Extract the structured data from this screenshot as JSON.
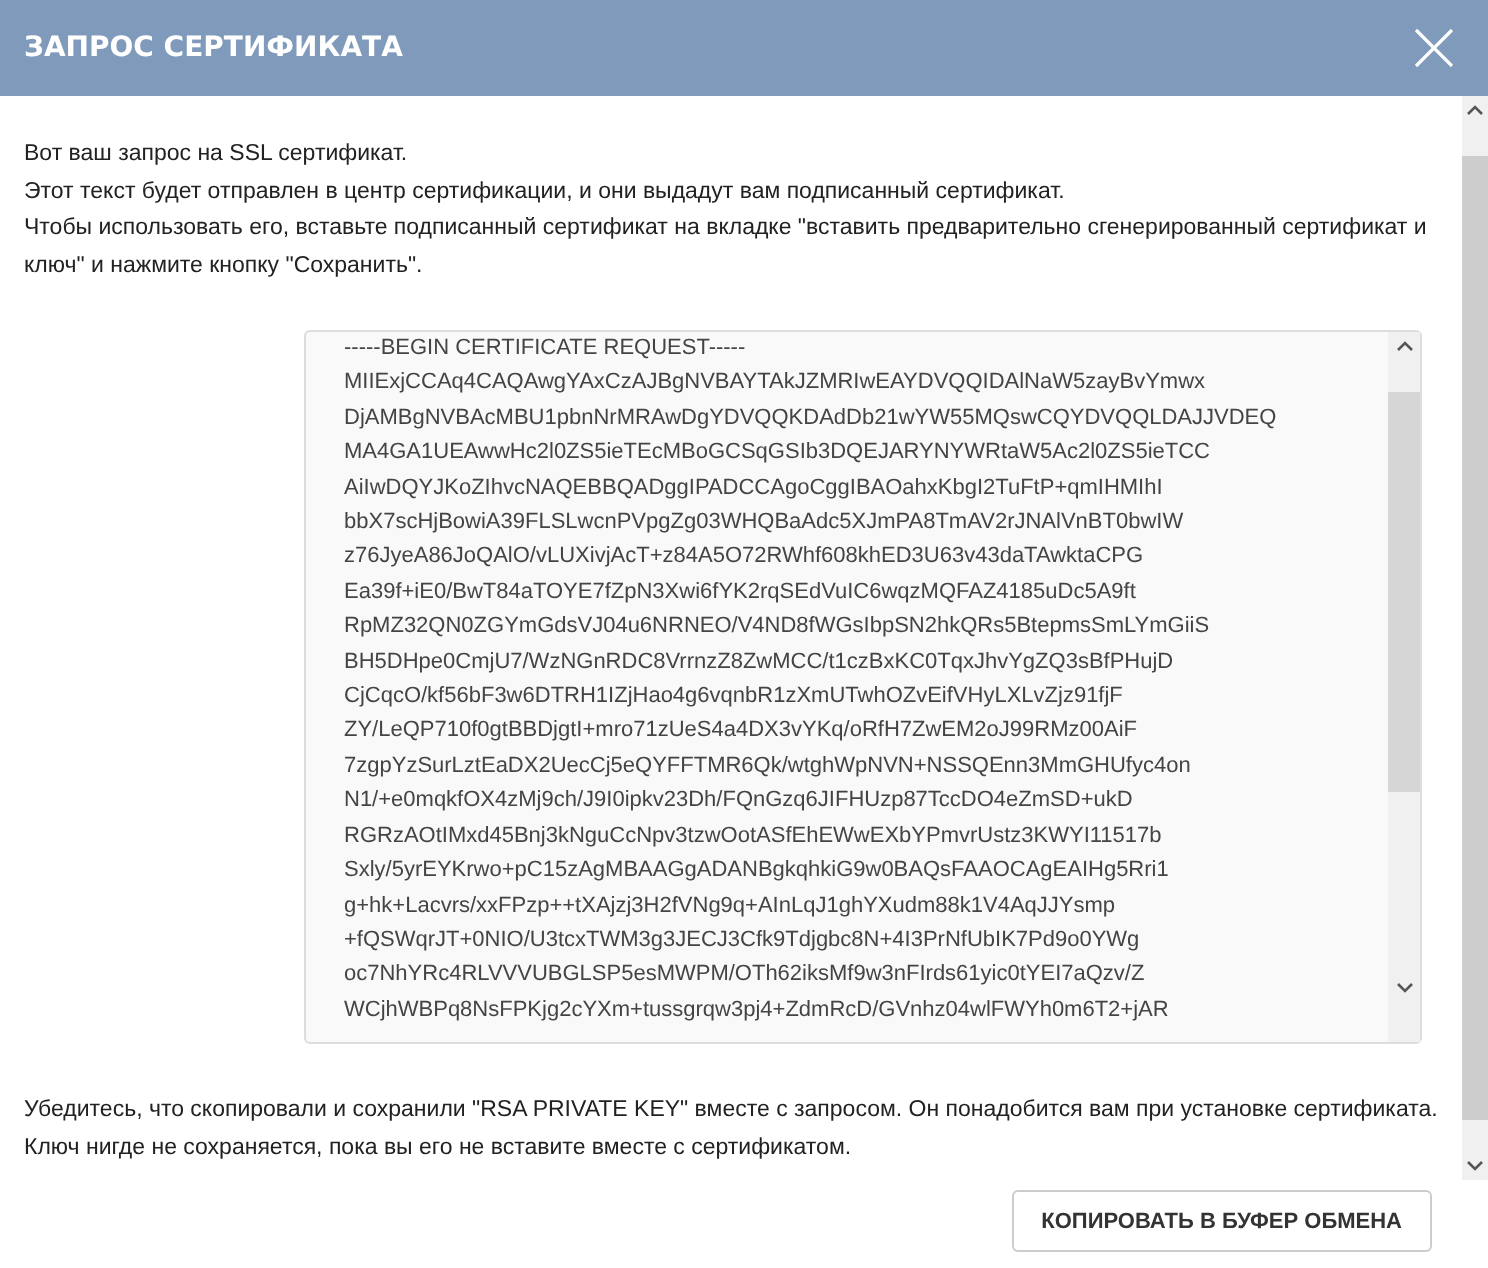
{
  "dialog": {
    "title": "ЗАПРОС СЕРТИФИКАТА"
  },
  "intro": [
    "Вот ваш запрос на SSL сертификат.",
    "Этот текст будет отправлен в центр сертификации, и они выдадут вам подписанный сертификат.",
    "Чтобы использовать его, вставьте подписанный сертификат на вкладке \"вставить предварительно сгенерированный сертификат и ключ\" и нажмите кнопку \"Сохранить\"."
  ],
  "certificate_request": {
    "lines": [
      "-----BEGIN CERTIFICATE REQUEST-----",
      "MIIExjCCAq4CAQAwgYAxCzAJBgNVBAYTAkJZMRIwEAYDVQQIDAlNaW5zayBvYmwx",
      "DjAMBgNVBAcMBU1pbnNrMRAwDgYDVQQKDAdDb21wYW55MQswCQYDVQQLDAJJVDEQ",
      "MA4GA1UEAwwHc2l0ZS5ieTEcMBoGCSqGSIb3DQEJARYNYWRtaW5Ac2l0ZS5ieTCC",
      "AiIwDQYJKoZIhvcNAQEBBQADggIPADCCAgoCggIBAOahxKbgI2TuFtP+qmIHMIhI",
      "bbX7scHjBowiA39FLSLwcnPVpgZg03WHQBaAdc5XJmPA8TmAV2rJNAlVnBT0bwIW",
      "z76JyeA86JoQAlO/vLUXivjAcT+z84A5O72RWhf608khED3U63v43daTAwktaCPG",
      "Ea39f+iE0/BwT84aTOYE7fZpN3Xwi6fYK2rqSEdVuIC6wqzMQFAZ4185uDc5A9ft",
      "RpMZ32QN0ZGYmGdsVJ04u6NRNEO/V4ND8fWGsIbpSN2hkQRs5BtepmsSmLYmGiiS",
      "BH5DHpe0CmjU7/WzNGnRDC8VrrnzZ8ZwMCC/t1czBxKC0TqxJhvYgZQ3sBfPHujD",
      "CjCqcO/kf56bF3w6DTRH1IZjHao4g6vqnbR1zXmUTwhOZvEifVHyLXLvZjz91fjF",
      "ZY/LeQP710f0gtBBDjgtI+mro71zUeS4a4DX3vYKq/oRfH7ZwEM2oJ99RMz00AiF",
      "7zgpYzSurLztEaDX2UecCj5eQYFFTMR6Qk/wtghWpNVN+NSSQEnn3MmGHUfyc4on",
      "N1/+e0mqkfOX4zMj9ch/J9I0ipkv23Dh/FQnGzq6JIFHUzp87TccDO4eZmSD+ukD",
      "RGRzAOtIMxd45Bnj3kNguCcNpv3tzwOotASfEhEWwEXbYPmvrUstz3KWYI11517b",
      "Sxly/5yrEYKrwo+pC15zAgMBAAGgADANBgkqhkiG9w0BAQsFAAOCAgEAIHg5Rri1",
      "g+hk+Lacvrs/xxFPzp++tXAjzj3H2fVNg9q+AInLqJ1ghYXudm88k1V4AqJJYsmp",
      "+fQSWqrJT+0NIO/U3tcxTWM3g3JECJ3Cfk9Tdjgbc8N+4I3PrNfUbIK7Pd9o0YWg",
      "oc7NhYRc4RLVVVUBGLSP5esMWPM/OTh62iksMf9w3nFIrds61yic0tYEI7aQzv/Z",
      "WCjhWBPq8NsFPKjg2cYXm+tussgrqw3pj4+ZdmRcD/GVnhz04wlFWYh0m6T2+jAR"
    ]
  },
  "notice": [
    "Убедитесь, что скопировали и сохранили \"RSA PRIVATE KEY\" вместе с запросом. Он понадобится вам при установке сертификата.",
    "Ключ нигде не сохраняется, пока вы его не вставите вместе с сертификатом."
  ],
  "buttons": [
    "КОПИРОВАТЬ В БУФЕР ОБМЕНА"
  ]
}
